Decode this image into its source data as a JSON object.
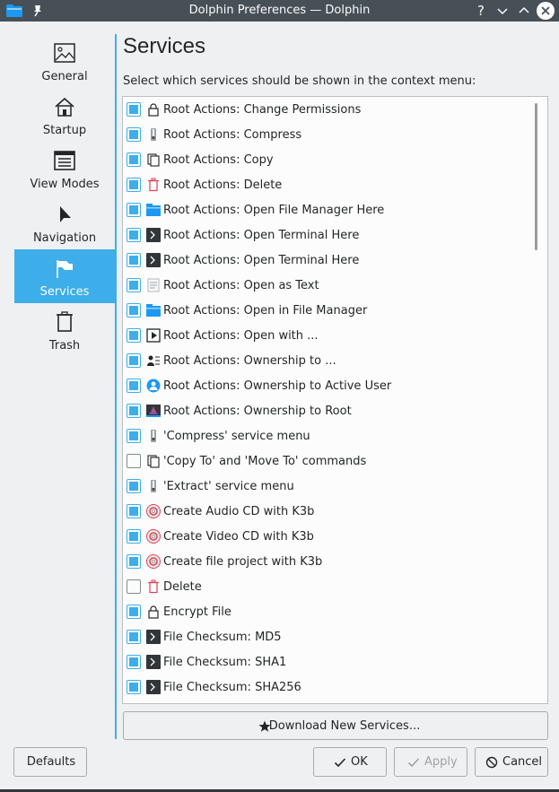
{
  "window": {
    "title": "Dolphin Preferences — Dolphin",
    "help": "?"
  },
  "sidebar": {
    "items": [
      {
        "label": "General",
        "icon": "image-icon"
      },
      {
        "label": "Startup",
        "icon": "home-icon"
      },
      {
        "label": "View Modes",
        "icon": "view-modes-icon"
      },
      {
        "label": "Navigation",
        "icon": "cursor-icon"
      },
      {
        "label": "Services",
        "icon": "flag-icon",
        "active": true
      },
      {
        "label": "Trash",
        "icon": "trash-icon"
      }
    ]
  },
  "main": {
    "title": "Services",
    "subtitle": "Select which services should be shown in the context menu:",
    "services": [
      {
        "label": "Root Actions: Change Permissions",
        "checked": true,
        "icon": "lock-icon"
      },
      {
        "label": "Root Actions: Compress",
        "checked": true,
        "icon": "archive-icon"
      },
      {
        "label": "Root Actions: Copy",
        "checked": true,
        "icon": "copy-icon"
      },
      {
        "label": "Root Actions: Delete",
        "checked": true,
        "icon": "trash-icon"
      },
      {
        "label": "Root Actions: Open File Manager Here",
        "checked": true,
        "icon": "folder-icon"
      },
      {
        "label": "Root Actions: Open Terminal Here",
        "checked": true,
        "icon": "terminal-icon"
      },
      {
        "label": "Root Actions: Open Terminal Here",
        "checked": true,
        "icon": "terminal-icon"
      },
      {
        "label": "Root Actions: Open as Text",
        "checked": true,
        "icon": "text-file-icon"
      },
      {
        "label": "Root Actions: Open in File Manager",
        "checked": true,
        "icon": "folder-icon"
      },
      {
        "label": "Root Actions: Open with ...",
        "checked": true,
        "icon": "open-with-icon"
      },
      {
        "label": "Root Actions: Ownership to ...",
        "checked": true,
        "icon": "user-list-icon"
      },
      {
        "label": "Root Actions: Ownership to Active User",
        "checked": true,
        "icon": "user-icon"
      },
      {
        "label": "Root Actions: Ownership to Root",
        "checked": true,
        "icon": "root-icon"
      },
      {
        "label": "'Compress' service menu",
        "checked": true,
        "icon": "archive-icon"
      },
      {
        "label": "'Copy To' and 'Move To' commands",
        "checked": false,
        "icon": "copy-icon"
      },
      {
        "label": "'Extract' service menu",
        "checked": true,
        "icon": "archive-icon"
      },
      {
        "label": "Create Audio CD with K3b",
        "checked": true,
        "icon": "k3b-icon"
      },
      {
        "label": "Create Video CD with K3b",
        "checked": true,
        "icon": "k3b-icon"
      },
      {
        "label": "Create file project with K3b",
        "checked": true,
        "icon": "k3b-icon"
      },
      {
        "label": "Delete",
        "checked": false,
        "icon": "trash-icon"
      },
      {
        "label": "Encrypt File",
        "checked": true,
        "icon": "lock-icon"
      },
      {
        "label": "File Checksum: MD5",
        "checked": true,
        "icon": "terminal-icon"
      },
      {
        "label": "File Checksum: SHA1",
        "checked": true,
        "icon": "terminal-icon"
      },
      {
        "label": "File Checksum: SHA256",
        "checked": true,
        "icon": "terminal-icon"
      }
    ],
    "download_label": "Download New Services..."
  },
  "footer": {
    "defaults_label": "Defaults",
    "ok_label": "OK",
    "apply_label": "Apply",
    "cancel_label": "Cancel"
  },
  "colors": {
    "accent": "#3daee9",
    "titlebar": "#475057",
    "window_bg": "#eff0f1",
    "list_bg": "#fcfcfc"
  }
}
